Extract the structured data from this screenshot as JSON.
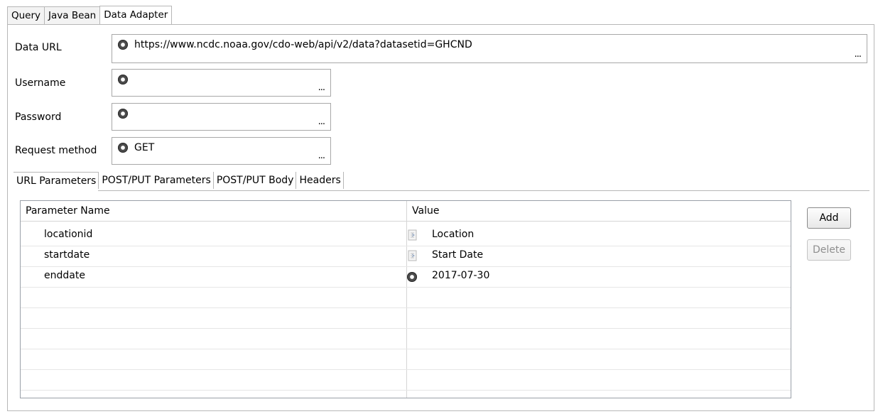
{
  "top_tabs": [
    {
      "label": "Query",
      "active": false
    },
    {
      "label": "Java Bean",
      "active": false
    },
    {
      "label": "Data Adapter",
      "active": true
    }
  ],
  "form": {
    "data_url": {
      "label": "Data URL",
      "value": "https://www.ncdc.noaa.gov/cdo-web/api/v2/data?datasetid=GHCND",
      "browse": "..."
    },
    "username": {
      "label": "Username",
      "value": "",
      "browse": "..."
    },
    "password": {
      "label": "Password",
      "value": "",
      "browse": "..."
    },
    "request_method": {
      "label": "Request method",
      "value": "GET",
      "browse": "..."
    }
  },
  "sub_tabs": [
    {
      "label": "URL Parameters",
      "active": true
    },
    {
      "label": "POST/PUT Parameters",
      "active": false
    },
    {
      "label": "POST/PUT Body",
      "active": false
    },
    {
      "label": "Headers",
      "active": false
    }
  ],
  "params_table": {
    "headers": [
      "Parameter Name",
      "Value"
    ],
    "rows": [
      {
        "name": "locationid",
        "value": "Location",
        "icon": "parameter-icon"
      },
      {
        "name": "startdate",
        "value": "Start Date",
        "icon": "parameter-icon"
      },
      {
        "name": "enddate",
        "value": "2017-07-30",
        "icon": "constant-value-icon"
      }
    ]
  },
  "buttons": {
    "add": "Add",
    "delete": "Delete"
  },
  "colors": {
    "border": "#b7b7b7",
    "table_border": "#9aa0a8",
    "disabled_text": "#8f8f8f"
  }
}
